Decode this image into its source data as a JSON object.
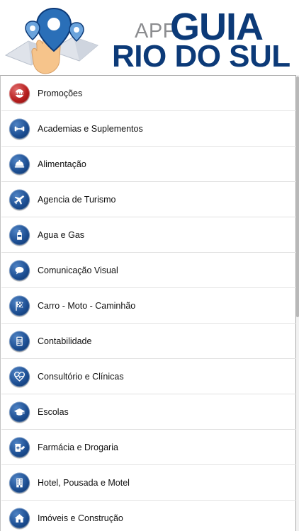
{
  "header": {
    "app": "APP",
    "guia": "GUIA",
    "city": "RIO DO SUL"
  },
  "menu": {
    "items": [
      {
        "label": "Promoções",
        "icon": "sale-badge-icon"
      },
      {
        "label": "Academias e Suplementos",
        "icon": "dumbbell-icon"
      },
      {
        "label": "Alimentação",
        "icon": "food-cloche-icon"
      },
      {
        "label": "Agencia de Turismo",
        "icon": "airplane-icon"
      },
      {
        "label": "Agua e Gas",
        "icon": "water-bottle-icon"
      },
      {
        "label": "Comunicação Visual",
        "icon": "chat-bubble-icon"
      },
      {
        "label": "Carro - Moto - Caminhão",
        "icon": "checkered-flag-icon"
      },
      {
        "label": "Contabilidade",
        "icon": "calculator-icon"
      },
      {
        "label": "Consultório e Clínicas",
        "icon": "heart-pulse-icon"
      },
      {
        "label": "Escolas",
        "icon": "graduation-cap-icon"
      },
      {
        "label": "Farmácia e Drogaria",
        "icon": "pills-icon"
      },
      {
        "label": "Hotel, Pousada e Motel",
        "icon": "building-icon"
      },
      {
        "label": "Imóveis e Construção",
        "icon": "house-icon"
      }
    ]
  },
  "colors": {
    "brand_blue": "#0c3a78",
    "brand_gray": "#8c8d90",
    "promo_red": "#b71e1e"
  }
}
